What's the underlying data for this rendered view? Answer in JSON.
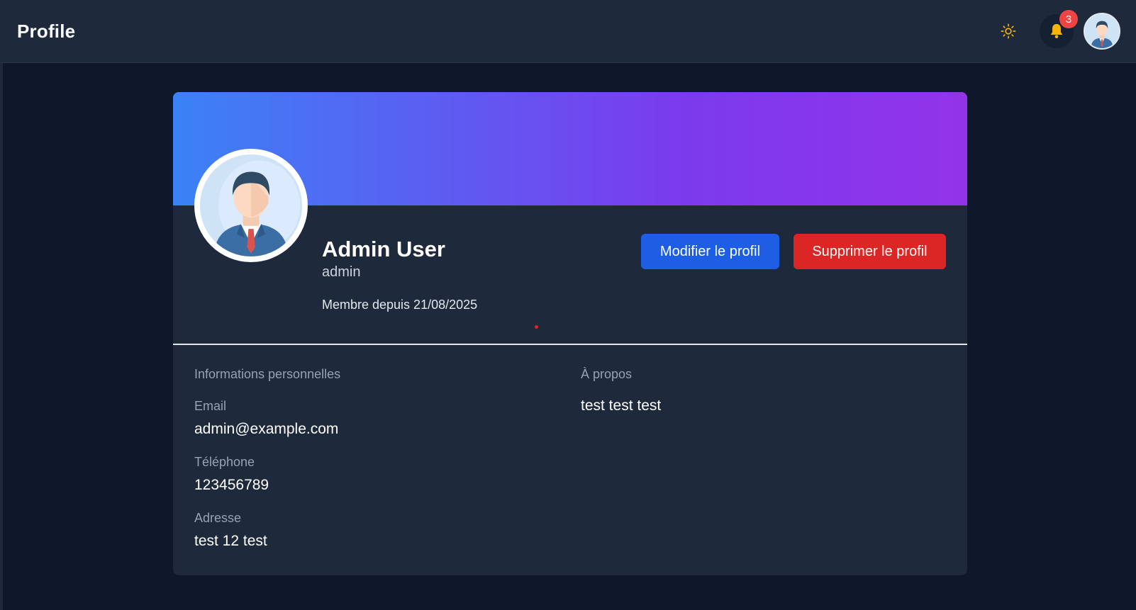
{
  "header": {
    "title": "Profile",
    "theme_icon": "sun-icon",
    "notifications_icon": "bell-icon",
    "notifications_count": "3",
    "avatar_icon": "user-avatar"
  },
  "profile": {
    "name": "Admin User",
    "username": "admin",
    "member_since": "Membre depuis 21/08/2025",
    "edit_label": "Modifier le profil",
    "delete_label": "Supprimer le profil"
  },
  "personal_info": {
    "title": "Informations personnelles",
    "fields": [
      {
        "label": "Email",
        "value": "admin@example.com"
      },
      {
        "label": "Téléphone",
        "value": "123456789"
      },
      {
        "label": "Adresse",
        "value": "test 12 test"
      }
    ]
  },
  "about": {
    "title": "À propos",
    "text": "test test test"
  },
  "colors": {
    "background": "#0f172a",
    "surface": "#1e293b",
    "banner_start": "#3b82f6",
    "banner_end": "#9333ea",
    "edit_button": "#1d5ee5",
    "delete_button": "#dc2626",
    "badge": "#ef4444",
    "sun": "#f5b40a"
  }
}
